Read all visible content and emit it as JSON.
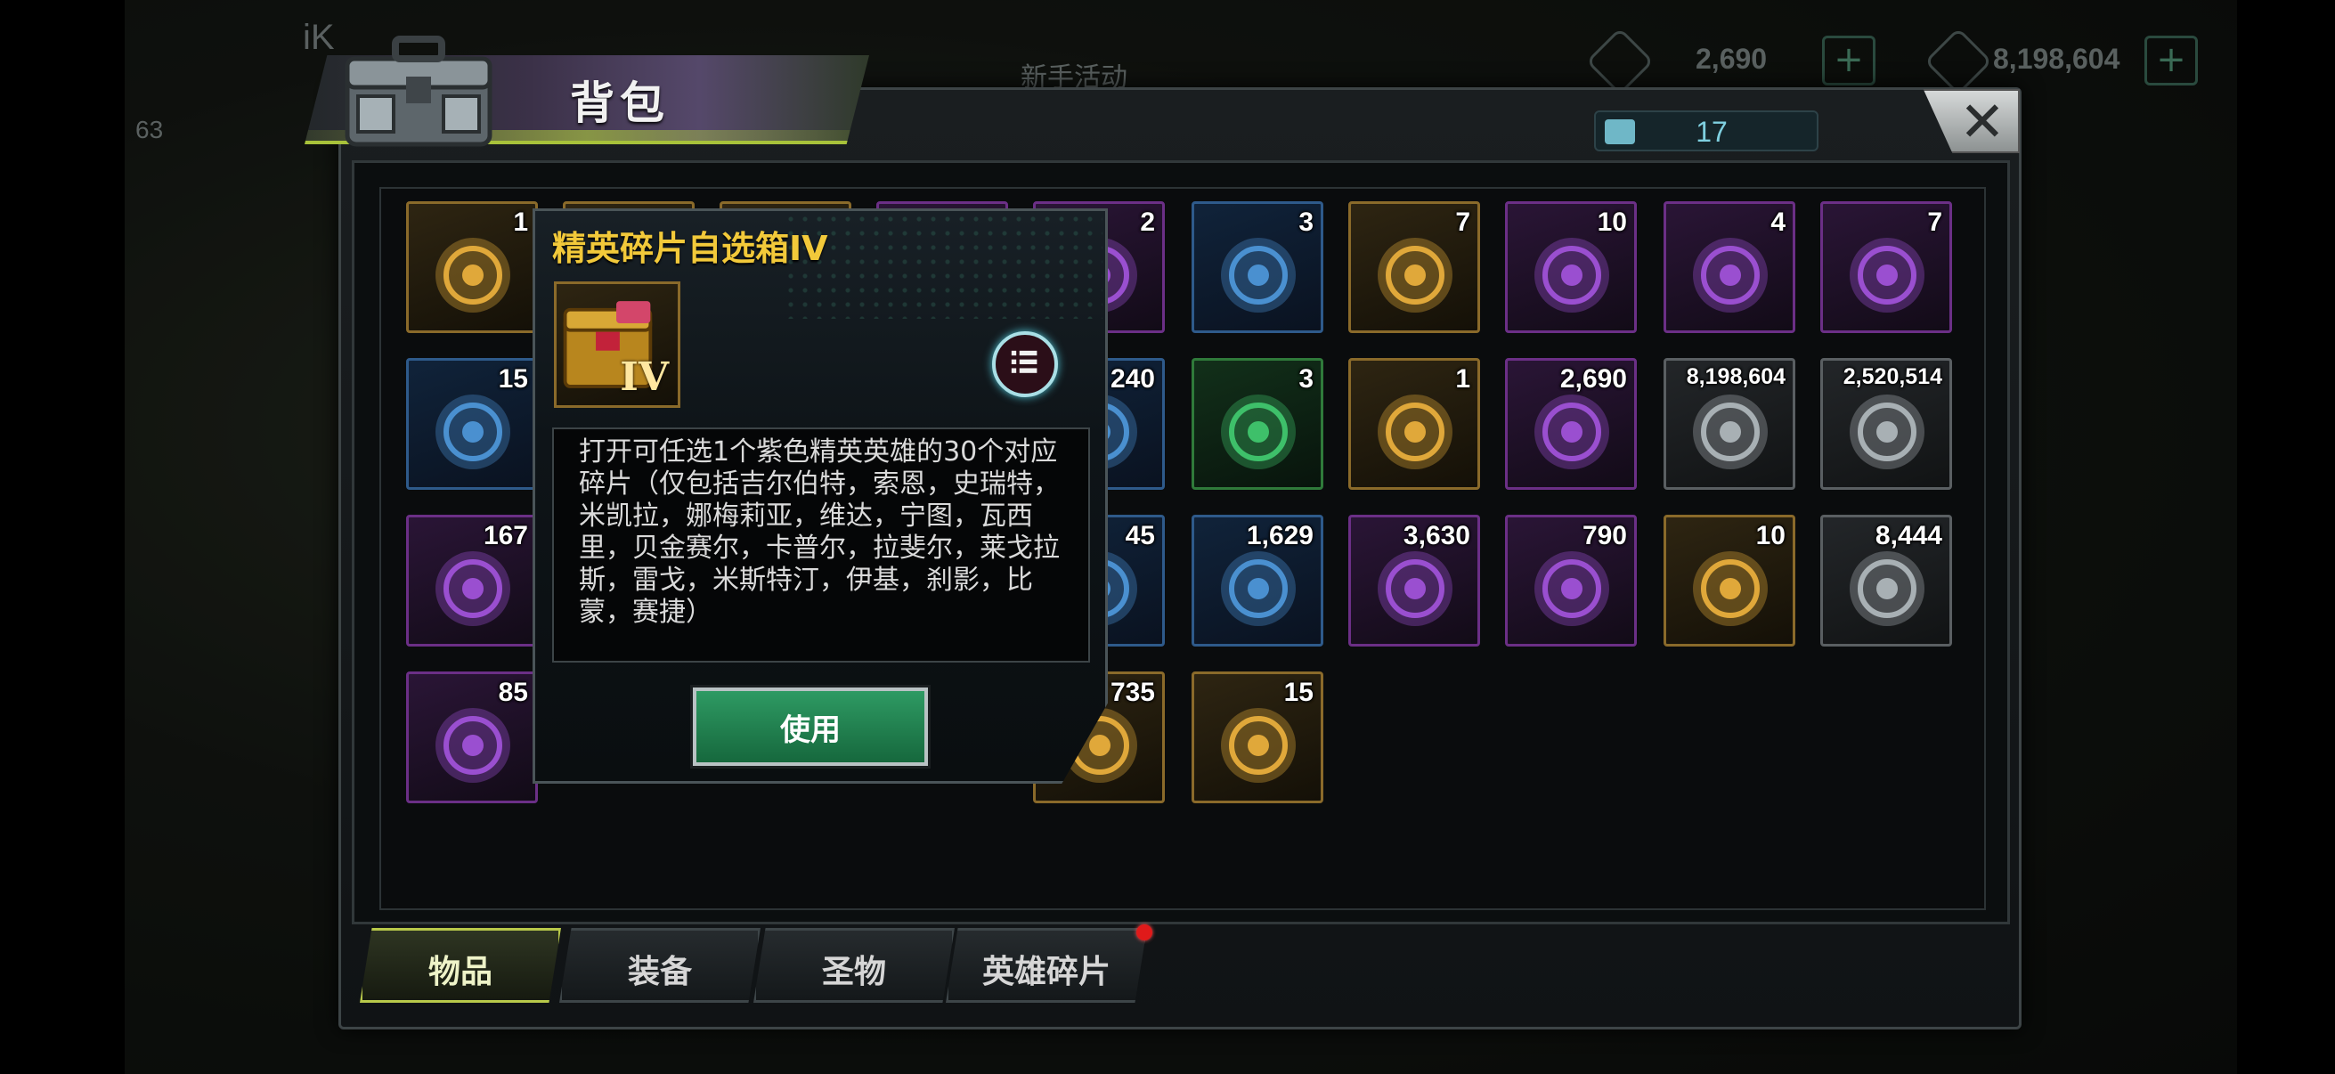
{
  "header": {
    "title": "背包",
    "capacity": "17",
    "close_label": "✕"
  },
  "hud": {
    "left_label": "iK",
    "level": "63",
    "event_label": "新手活动",
    "currency_1": "2,690",
    "currency_2": "8,198,604"
  },
  "grid": {
    "items": [
      {
        "count": "1",
        "rarity": "gold",
        "icon": "elite-shard-chest-icon"
      },
      {
        "count": "",
        "rarity": "gold",
        "icon": "hidden-item-icon"
      },
      {
        "count": "",
        "rarity": "gold",
        "icon": "hidden-item-icon"
      },
      {
        "count": "",
        "rarity": "purple",
        "icon": "hidden-item-icon"
      },
      {
        "count": "2",
        "rarity": "purple",
        "icon": "coin-book-icon"
      },
      {
        "count": "3",
        "rarity": "blue",
        "icon": "speedup-4h-icon"
      },
      {
        "count": "7",
        "rarity": "gold",
        "icon": "lips-badge-icon"
      },
      {
        "count": "10",
        "rarity": "purple",
        "icon": "film-reel-icon"
      },
      {
        "count": "4",
        "rarity": "purple",
        "icon": "token-bottlecap-icon"
      },
      {
        "count": "7",
        "rarity": "purple",
        "icon": "police-badge-icon"
      },
      {
        "count": "15",
        "rarity": "blue",
        "icon": "cocktail-s02-icon"
      },
      {
        "count": "240",
        "rarity": "blue",
        "icon": "hidden-item-icon"
      },
      {
        "count": "3",
        "rarity": "green",
        "icon": "swim-ring-icon"
      },
      {
        "count": "1",
        "rarity": "gold",
        "icon": "weapon-card-icon"
      },
      {
        "count": "2,690",
        "rarity": "purple",
        "icon": "purple-crystal-icon"
      },
      {
        "count": "8,198,604",
        "rarity": "grey",
        "icon": "gold-coins-icon"
      },
      {
        "count": "2,520,514",
        "rarity": "grey",
        "icon": "toxic-canister-icon"
      },
      {
        "count": "167",
        "rarity": "purple",
        "icon": "purple-core-icon"
      },
      {
        "count": "45",
        "rarity": "blue",
        "icon": "hidden-item-icon"
      },
      {
        "count": "1,629",
        "rarity": "blue",
        "icon": "fist-icon"
      },
      {
        "count": "3,630",
        "rarity": "purple",
        "icon": "puzzle-piece-icon"
      },
      {
        "count": "790",
        "rarity": "purple",
        "icon": "ship-gear-icon"
      },
      {
        "count": "10",
        "rarity": "gold",
        "icon": "gold-ship-gear-icon"
      },
      {
        "count": "8,444",
        "rarity": "grey",
        "icon": "biohazard-crate-icon"
      },
      {
        "count": "85",
        "rarity": "purple",
        "icon": "energy-bolt-icon"
      },
      {
        "count": "735",
        "rarity": "gold",
        "icon": "hidden-item-icon"
      },
      {
        "count": "15",
        "rarity": "gold",
        "icon": "dna-helix-icon"
      }
    ]
  },
  "tabs": [
    {
      "label": "物品",
      "active": true
    },
    {
      "label": "装备",
      "active": false
    },
    {
      "label": "圣物",
      "active": false
    },
    {
      "label": "英雄碎片",
      "active": false
    }
  ],
  "popup": {
    "title": "精英碎片自选箱IV",
    "description": "打开可任选1个紫色精英英雄的30个对应碎片（仅包括吉尔伯特，索恩，史瑞特，米凯拉，娜梅莉亚，维达，宁图，瓦西里，贝金赛尔，卡普尔，拉斐尔，莱戈拉斯，雷戈，米斯特汀，伊基，刹影，比蒙，赛捷）",
    "use_label": "使用",
    "icon_label": "IV"
  },
  "colors": {
    "accent_title": "#f2c93a",
    "use_button": "#1f8a52",
    "tab_active_border": "#b8c94a",
    "notify_dot": "#e01a1a"
  }
}
